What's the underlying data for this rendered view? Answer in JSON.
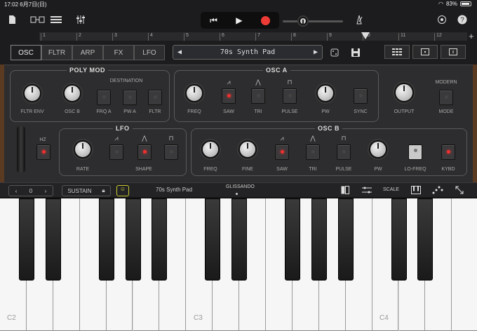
{
  "status": {
    "time": "17:02",
    "date": "6月7日(日)",
    "battery": "83%"
  },
  "ruler": {
    "marks": [
      "1",
      "2",
      "3",
      "4",
      "5",
      "6",
      "7",
      "8",
      "9",
      "10",
      "11",
      "12"
    ]
  },
  "tabs": [
    {
      "label": "OSC",
      "active": true
    },
    {
      "label": "FLTR",
      "active": false
    },
    {
      "label": "ARP",
      "active": false
    },
    {
      "label": "FX",
      "active": false
    },
    {
      "label": "LFO",
      "active": false
    }
  ],
  "patch": {
    "name": "70s Synth Pad",
    "prev": "◀",
    "next": "▶"
  },
  "poly_mod": {
    "title": "POLY MOD",
    "knobs": [
      "FLTR ENV",
      "OSC B"
    ],
    "destination_title": "DESTINATION",
    "destinations": [
      "FRQ A",
      "PW A",
      "FLTR"
    ]
  },
  "osc_a": {
    "title": "OSC A",
    "freq": "FREQ",
    "saw": "SAW",
    "tri": "TRI",
    "pulse": "PULSE",
    "pw": "PW",
    "sync": "SYNC"
  },
  "output": {
    "label": "OUTPUT",
    "modern_title": "MODERN",
    "mode": "MODE"
  },
  "lfo": {
    "title": "LFO",
    "hz": "HZ",
    "rate": "RATE",
    "shape": "SHAPE"
  },
  "osc_b": {
    "title": "OSC B",
    "freq": "FREQ",
    "fine": "FINE",
    "saw": "SAW",
    "tri": "TRI",
    "pulse": "PULSE",
    "pw": "PW",
    "lofreq": "LO-FREQ",
    "kybd": "KYBD"
  },
  "kbstrip": {
    "octave": "0",
    "sustain": "SUSTAIN",
    "patch_name": "70s Synth Pad",
    "glissando": "GLISSANDO",
    "scale": "SCALE"
  },
  "keyboard": {
    "labels": [
      "C2",
      "C3",
      "C4"
    ]
  }
}
